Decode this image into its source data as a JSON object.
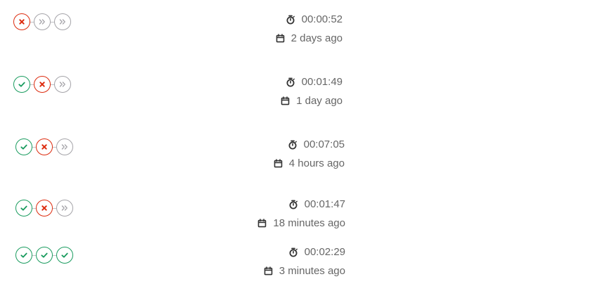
{
  "colors": {
    "success": "#1a9c5f",
    "failed": "#dd2b0e",
    "skipped": "#a4a3a8",
    "text": "#666666"
  },
  "pipelines": [
    {
      "stages": [
        "failed",
        "skipped",
        "skipped"
      ],
      "duration": "00:00:52",
      "finished": "2 days ago"
    },
    {
      "stages": [
        "success",
        "failed",
        "skipped"
      ],
      "duration": "00:01:49",
      "finished": "1 day ago"
    },
    {
      "stages": [
        "success",
        "failed",
        "skipped"
      ],
      "duration": "00:07:05",
      "finished": "4 hours ago"
    },
    {
      "stages": [
        "success",
        "failed",
        "skipped"
      ],
      "duration": "00:01:47",
      "finished": "18 minutes ago"
    },
    {
      "stages": [
        "success",
        "success",
        "success"
      ],
      "duration": "00:02:29",
      "finished": "3 minutes ago"
    }
  ],
  "icons": {
    "duration": "timer-icon",
    "finished": "calendar-icon",
    "success": "check-circle-icon",
    "failed": "x-circle-icon",
    "skipped": "skipped-chevrons-icon"
  }
}
